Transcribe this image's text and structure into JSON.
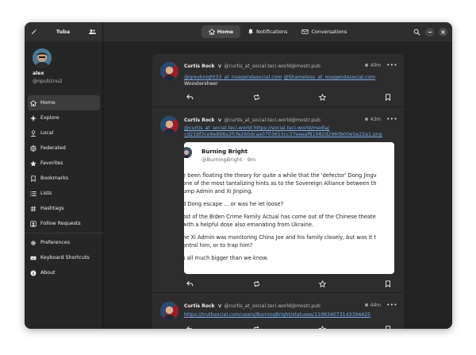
{
  "window": {
    "app_title": "Tuba",
    "tabs": [
      {
        "label": "Home",
        "icon": "home-icon"
      },
      {
        "label": "Notifications",
        "icon": "bell-icon"
      },
      {
        "label": "Conversations",
        "icon": "mail-icon"
      }
    ]
  },
  "user": {
    "name": "alex",
    "handle": "@npub1nu2"
  },
  "nav": {
    "primary": [
      {
        "label": "Home",
        "icon": "home-icon"
      },
      {
        "label": "Explore",
        "icon": "compass-icon"
      },
      {
        "label": "Local",
        "icon": "user-icon"
      },
      {
        "label": "Federated",
        "icon": "globe-icon"
      },
      {
        "label": "Favorites",
        "icon": "star-icon"
      },
      {
        "label": "Bookmarks",
        "icon": "bookmark-icon"
      },
      {
        "label": "Lists",
        "icon": "list-icon"
      },
      {
        "label": "Hashtags",
        "icon": "hashtag-icon"
      },
      {
        "label": "Follow Requests",
        "icon": "follow-request-icon"
      }
    ],
    "secondary": [
      {
        "label": "Preferences",
        "icon": "gear-icon"
      },
      {
        "label": "Keyboard Shortcuts",
        "icon": "keyboard-icon"
      },
      {
        "label": "About",
        "icon": "info-icon"
      }
    ]
  },
  "posts": [
    {
      "author": "Curtis Rock",
      "handle": "@curtis_at_social.teci.world@mostr.pub",
      "time": "40m",
      "links": [
        "@greyknight33_at_noagendasocial.com",
        "@Shameless_at_noagendasocial.com"
      ],
      "text": "Woostersheer"
    },
    {
      "author": "Curtis Rock",
      "handle": "@curtis_at_social.teci.world@mostr.pub",
      "time": "43m",
      "link_line1": "@curtis_at_social.teci.world https://social.teci.world/media/",
      "link_line2": "cd21bf3ce9e898a2fcfe260dcaa0703653cc37eeeaf81982d2960b00e5e22a1.png",
      "card": {
        "name": "Burning Bright",
        "handle": "@BurningBright · 9m",
        "lines": [
          "e been floating the theory for quite a while that the 'defector' Dong Jingv",
          " one of the most tantalizing hints as to the Sovereign Alliance between th",
          "ump Admin and Xi Jinping.",
          "d Dong escape ... or was he let loose?",
          "ost of the Biden Crime Family Actual has come out of the Chinese theate",
          " with a helpful dose also emanating from Ukraine.",
          "he Xi Admin was monitoring China Joe and his family closely, but was it t",
          "ontrol him, or to trap him?",
          "s all much bigger than we know."
        ]
      }
    },
    {
      "author": "Curtis Rock",
      "handle": "@curtis_at_social.teci.world@mostr.pub",
      "time": "44m",
      "link": "https://truthsocial.com/users/BurningBright/statuses/110634073143394425"
    }
  ]
}
